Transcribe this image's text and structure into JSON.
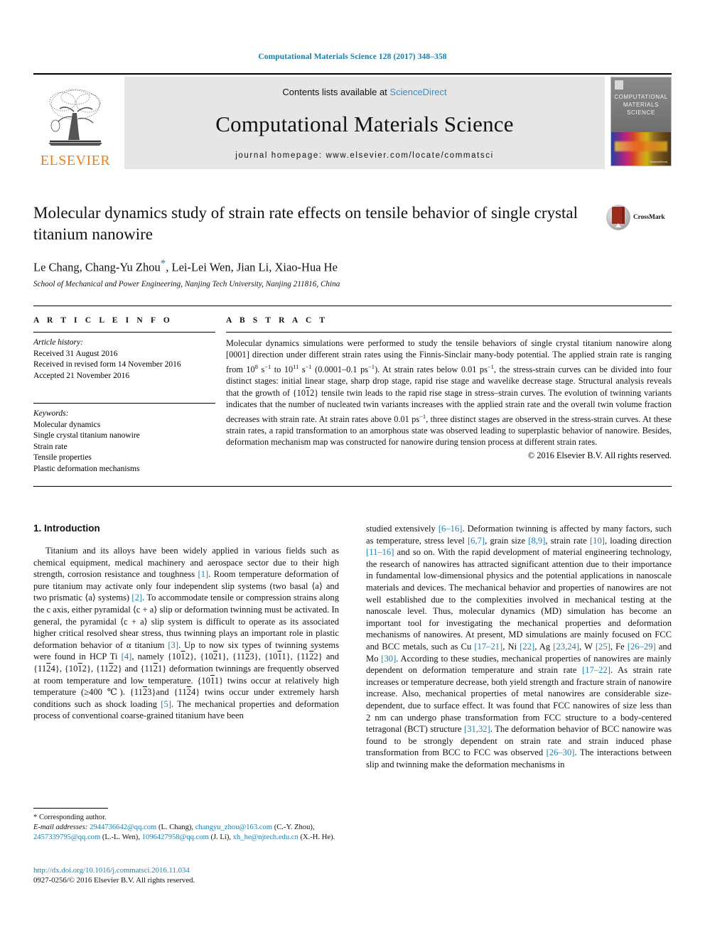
{
  "running_head": "Computational Materials Science 128 (2017) 348–358",
  "masthead": {
    "contents_prefix": "Contents lists available at",
    "sciencedirect": "ScienceDirect",
    "journal_title": "Computational Materials Science",
    "homepage": "journal homepage: www.elsevier.com/locate/commatsci",
    "publisher_word": "ELSEVIER",
    "cover_title_line1": "COMPUTATIONAL",
    "cover_title_line2": "MATERIALS",
    "cover_title_line3": "SCIENCE",
    "cover_footer": "ScienceDirect"
  },
  "article": {
    "title": "Molecular dynamics study of strain rate effects on tensile behavior of single crystal titanium nanowire",
    "authors": "Le Chang, Chang-Yu Zhou",
    "authors_rest": ", Lei-Lei Wen, Jian Li, Xiao-Hua He",
    "corresponding_marker": "*",
    "affiliation": "School of Mechanical and Power Engineering, Nanjing Tech University, Nanjing 211816, China",
    "crossmark_label": "CrossMark"
  },
  "article_info": {
    "heading": "A R T I C L E    I N F O",
    "history_label": "Article history:",
    "history": [
      "Received 31 August 2016",
      "Received in revised form 14 November 2016",
      "Accepted 21 November 2016"
    ],
    "keywords_label": "Keywords:",
    "keywords": [
      "Molecular dynamics",
      "Single crystal titanium nanowire",
      "Strain rate",
      "Tensile properties",
      "Plastic deformation mechanisms"
    ]
  },
  "abstract": {
    "heading": "A B S T R A C T",
    "copyright": "© 2016 Elsevier B.V. All rights reserved."
  },
  "introduction": {
    "heading": "1. Introduction"
  },
  "footnote": {
    "corresponding": "* Corresponding author.",
    "email_label": "E-mail addresses:",
    "emails": [
      {
        "address": "2944736642@qq.com",
        "name": "(L. Chang)"
      },
      {
        "address": "changyu_zhou@163.com",
        "name": "(C.-Y. Zhou)"
      },
      {
        "address": "2457339795@qq.com",
        "name": "(L.-L. Wen)"
      },
      {
        "address": "1096427958@qq.com",
        "name": "(J. Li)"
      },
      {
        "address": "xh_he@njtech.edu.cn",
        "name": "(X.-H. He)"
      }
    ]
  },
  "footer": {
    "doi": "http://dx.doi.org/10.1016/j.commatsci.2016.11.034",
    "issn": "0927-0256/© 2016 Elsevier B.V. All rights reserved."
  },
  "colors": {
    "link_blue": "#1f7fad",
    "header_blue": "#1a7fa8",
    "elsevier_orange": "#f07f13",
    "sciencedirect_blue": "#3c8cc4",
    "crossmark_red": "#9c2b1e"
  }
}
